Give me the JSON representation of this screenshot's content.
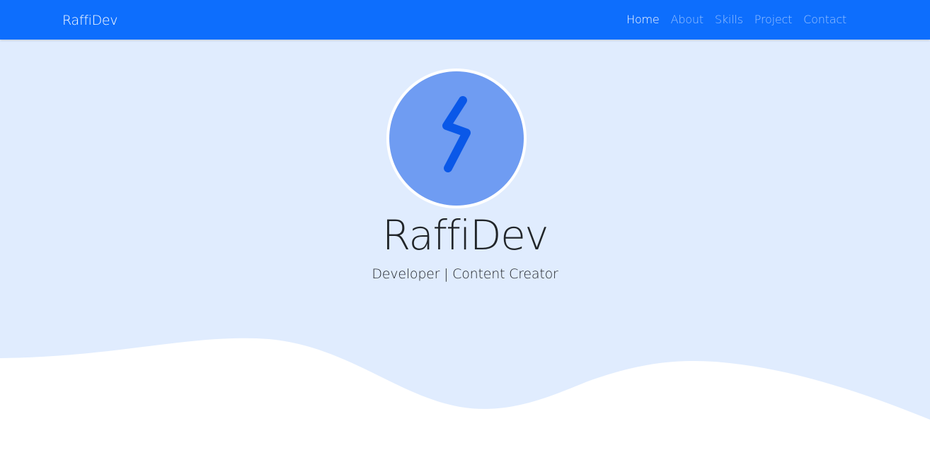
{
  "navbar": {
    "brand": "RaffiDev",
    "links": [
      {
        "label": "Home",
        "active": true
      },
      {
        "label": "About",
        "active": false
      },
      {
        "label": "Skills",
        "active": false
      },
      {
        "label": "Project",
        "active": false
      },
      {
        "label": "Contact",
        "active": false
      }
    ]
  },
  "hero": {
    "title": "RaffiDev",
    "subtitle": "Developer | Content Creator",
    "avatar_icon": "lightning-bolt-icon"
  },
  "colors": {
    "navbar_bg": "#0d6efd",
    "hero_bg": "#e0ecfe",
    "avatar_bg": "#6f9cf2",
    "bolt": "#0a58e8",
    "text": "#212529",
    "nav_link": "rgba(255,255,255,0.58)",
    "nav_link_active": "#ffffff"
  }
}
